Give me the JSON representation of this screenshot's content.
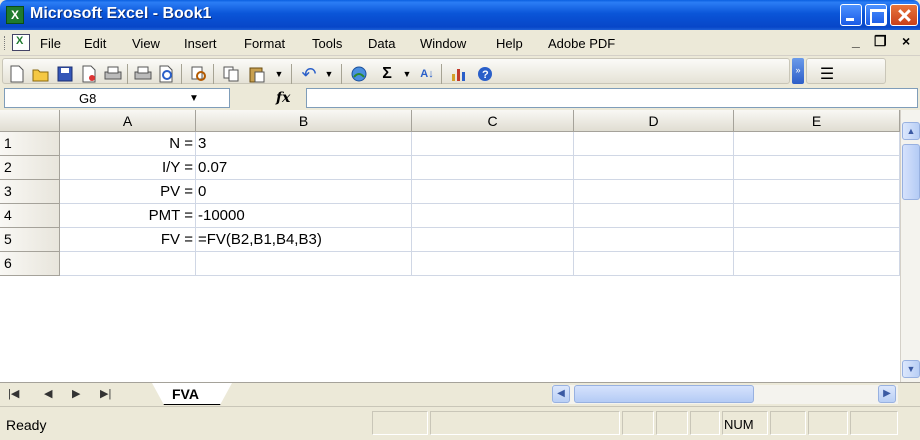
{
  "window": {
    "title": "Microsoft Excel - Book1"
  },
  "menu": {
    "items": [
      "File",
      "Edit",
      "View",
      "Insert",
      "Format",
      "Tools",
      "Data",
      "Window",
      "Help",
      "Adobe PDF"
    ]
  },
  "toolbar": {
    "icons": [
      "new-icon",
      "open-icon",
      "save-icon",
      "permission-icon",
      "print-icon",
      "print-preview-icon",
      "research-icon",
      "copy-icon",
      "paste-icon",
      "undo-icon",
      "hyperlink-icon",
      "autosum-icon",
      "sort-ascending-icon",
      "chart-wizard-icon",
      "help-icon"
    ]
  },
  "formula_bar": {
    "name_box": "G8",
    "fx": "fx",
    "formula": ""
  },
  "sheet": {
    "columns": [
      "A",
      "B",
      "C",
      "D",
      "E"
    ],
    "rows": [
      {
        "num": "1",
        "a": "N =",
        "b": "3"
      },
      {
        "num": "2",
        "a": "I/Y =",
        "b": "0.07"
      },
      {
        "num": "3",
        "a": "PV =",
        "b": "0"
      },
      {
        "num": "4",
        "a": "PMT =",
        "b": "-10000"
      },
      {
        "num": "5",
        "a": "FV =",
        "b": "=FV(B2,B1,B4,B3)"
      },
      {
        "num": "6",
        "a": "",
        "b": ""
      }
    ]
  },
  "tabs": {
    "active": "FVA"
  },
  "status": {
    "mode": "Ready",
    "num_lock": "NUM"
  }
}
